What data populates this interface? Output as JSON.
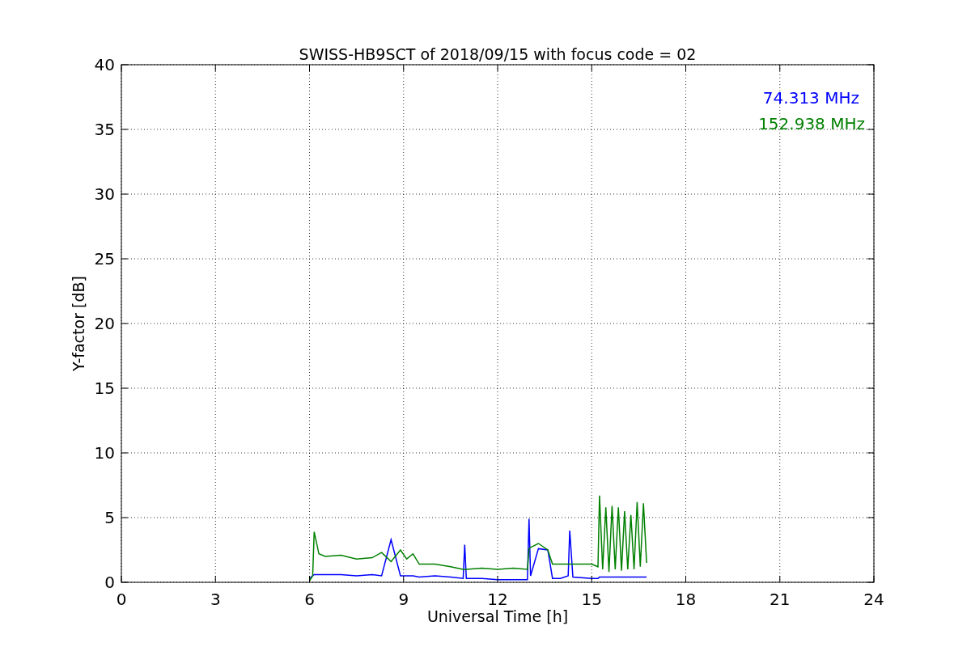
{
  "figure": {
    "chart_data": {
      "type": "line",
      "title": "SWISS-HB9SCT of 2018/09/15 with focus code = 02",
      "xlabel": "Universal Time [h]",
      "ylabel": "Y-factor [dB]",
      "x": [
        6,
        6.1,
        6.15,
        6.3,
        6.5,
        7,
        7.5,
        8,
        8.3,
        8.6,
        8.9,
        9.1,
        9.3,
        9.5,
        10,
        10.5,
        10.9,
        10.95,
        11,
        11.5,
        12,
        12.5,
        12.95,
        13,
        13.05,
        13.3,
        13.6,
        13.75,
        14,
        14.25,
        14.3,
        14.4,
        15,
        15.2,
        15.25,
        15.35,
        15.45,
        15.55,
        15.65,
        15.75,
        15.85,
        15.95,
        16.05,
        16.15,
        16.25,
        16.35,
        16.45,
        16.55,
        16.65,
        16.75
      ],
      "series": [
        {
          "name": "74.313 MHz",
          "color": "#0000ff",
          "values": [
            0.3,
            0.5,
            0.6,
            0.6,
            0.6,
            0.6,
            0.5,
            0.6,
            0.5,
            3.3,
            0.5,
            0.5,
            0.5,
            0.4,
            0.5,
            0.4,
            0.3,
            2.9,
            0.3,
            0.3,
            0.2,
            0.2,
            0.2,
            4.9,
            0.5,
            2.6,
            2.5,
            0.3,
            0.3,
            0.5,
            4.0,
            0.4,
            0.3,
            0.3,
            0.4,
            0.4,
            0.4,
            0.4,
            0.4,
            0.4,
            0.4,
            0.4,
            0.4,
            0.4,
            0.4,
            0.4,
            0.4,
            0.4,
            0.4,
            0.4
          ]
        },
        {
          "name": "152.938 MHz",
          "color": "#008000",
          "values": [
            0.1,
            0.5,
            3.9,
            2.2,
            2.0,
            2.1,
            1.8,
            1.9,
            2.3,
            1.6,
            2.5,
            1.8,
            2.2,
            1.4,
            1.4,
            1.2,
            1.0,
            1.0,
            1.0,
            1.1,
            1.0,
            1.1,
            1.0,
            2.6,
            2.7,
            3.0,
            2.5,
            1.4,
            1.4,
            1.4,
            1.4,
            1.4,
            1.4,
            1.2,
            6.7,
            1.0,
            5.8,
            0.8,
            5.9,
            1.0,
            5.8,
            0.9,
            5.5,
            1.0,
            5.2,
            1.0,
            6.2,
            1.2,
            6.1,
            1.5
          ]
        }
      ],
      "grid": true,
      "xlim": [
        0,
        24
      ],
      "ylim": [
        0,
        40
      ],
      "xticks": [
        0,
        3,
        6,
        9,
        12,
        15,
        18,
        21,
        24
      ],
      "yticks": [
        0,
        5,
        10,
        15,
        20,
        25,
        30,
        35,
        40
      ]
    }
  }
}
